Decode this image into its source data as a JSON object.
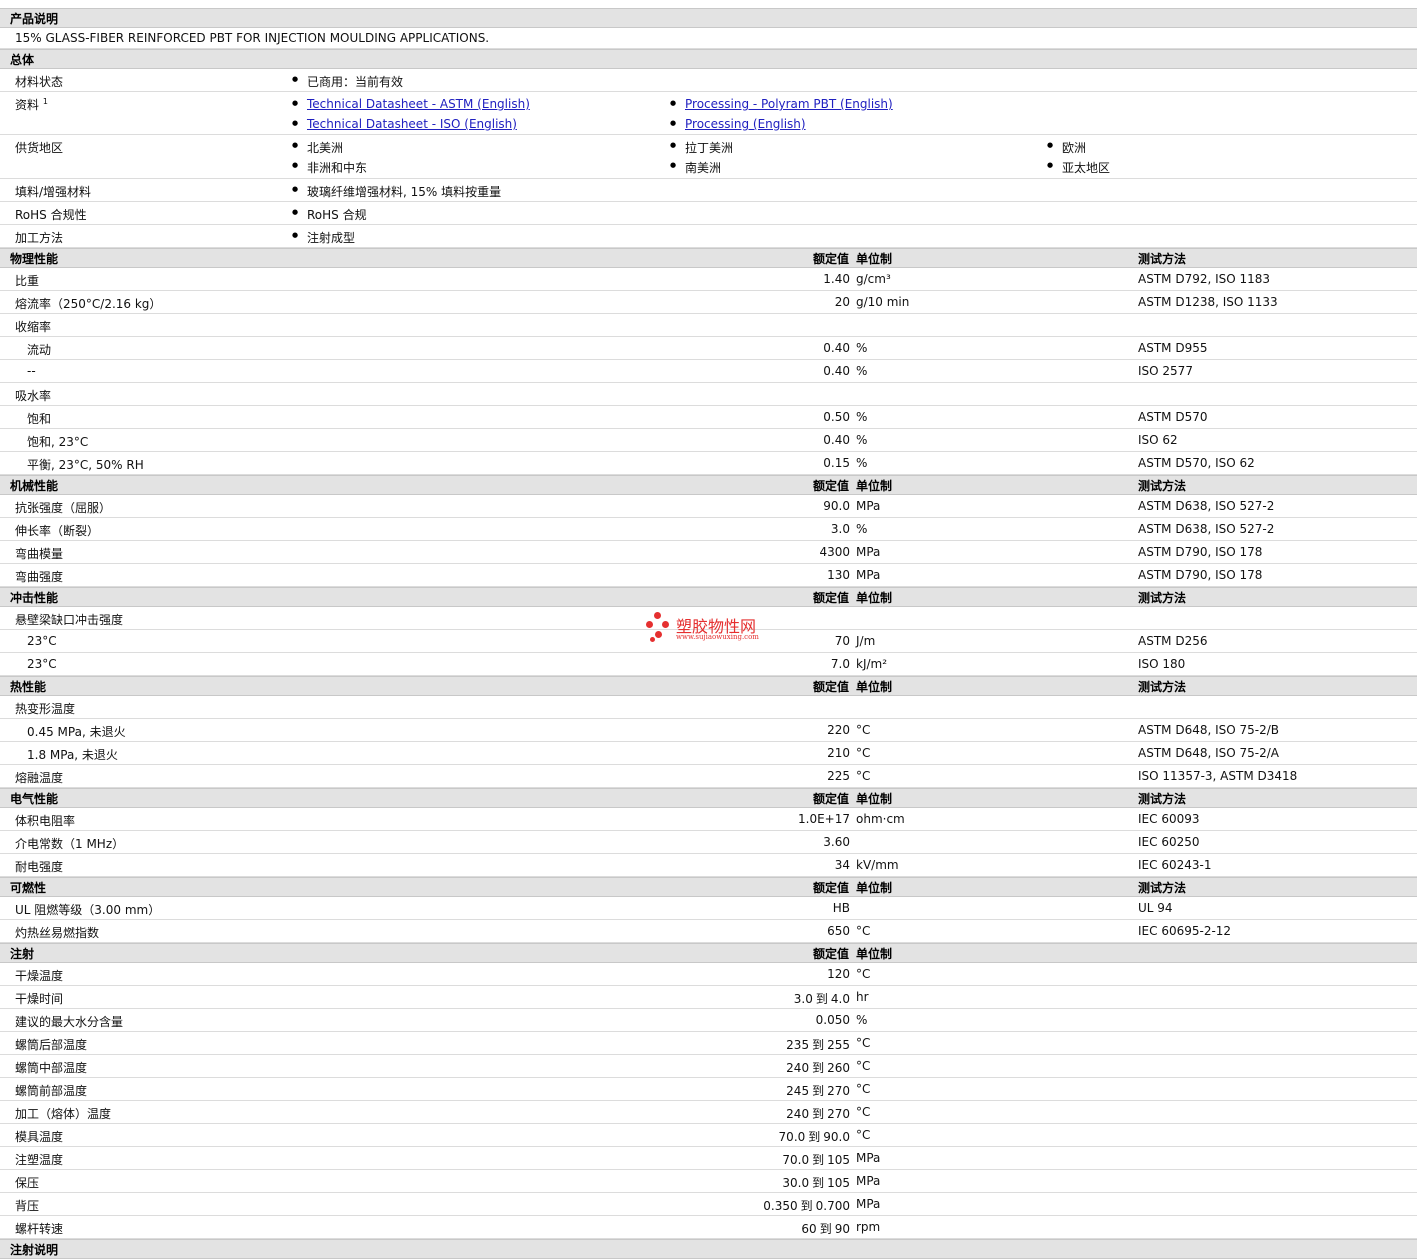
{
  "sections": {
    "desc": "产品说明",
    "general": "总体",
    "physical": "物理性能",
    "mechanical": "机械性能",
    "impact": "冲击性能",
    "thermal": "热性能",
    "electrical": "电气性能",
    "flammability": "可燃性",
    "injection": "注射",
    "injection_notes": "注射说明"
  },
  "headers": {
    "value": "额定值",
    "unit": "单位制",
    "method": "测试方法"
  },
  "description": "15% GLASS-FIBER REINFORCED PBT FOR INJECTION MOULDING APPLICATIONS.",
  "general": {
    "status_label": "材料状态",
    "status_value": "已商用：当前有效",
    "docs_label": "资料",
    "docs_sup": "1",
    "docs": [
      "Technical Datasheet - ASTM (English)",
      "Processing - Polyram PBT (English)",
      "Technical Datasheet - ISO (English)",
      "Processing (English)"
    ],
    "regions_label": "供货地区",
    "regions": [
      "北美洲",
      "拉丁美洲",
      "欧洲",
      "非洲和中东",
      "南美洲",
      "亚太地区"
    ],
    "filler_label": "填料/增强材料",
    "filler_value": "玻璃纤维增强材料, 15% 填料按重量",
    "rohs_label": "RoHS 合规性",
    "rohs_value": "RoHS 合规",
    "process_label": "加工方法",
    "process_value": "注射成型"
  },
  "physical": [
    {
      "label": "比重",
      "value": "1.40",
      "unit": "g/cm³",
      "method": "ASTM D792, ISO 1183"
    },
    {
      "label": "熔流率（250°C/2.16 kg）",
      "value": "20",
      "unit": "g/10 min",
      "method": "ASTM D1238, ISO 1133"
    },
    {
      "label": "收缩率",
      "value": "",
      "unit": "",
      "method": ""
    },
    {
      "label": "流动",
      "value": "0.40",
      "unit": "%",
      "method": "ASTM D955"
    },
    {
      "label": "--",
      "value": "0.40",
      "unit": "%",
      "method": "ISO 2577"
    },
    {
      "label": "吸水率",
      "value": "",
      "unit": "",
      "method": ""
    },
    {
      "label": "饱和",
      "value": "0.50",
      "unit": "%",
      "method": "ASTM D570"
    },
    {
      "label": "饱和, 23°C",
      "value": "0.40",
      "unit": "%",
      "method": "ISO 62"
    },
    {
      "label": "平衡, 23°C, 50% RH",
      "value": "0.15",
      "unit": "%",
      "method": "ASTM D570, ISO 62"
    }
  ],
  "mechanical": [
    {
      "label": "抗张强度（屈服）",
      "value": "90.0",
      "unit": "MPa",
      "method": "ASTM D638, ISO 527-2"
    },
    {
      "label": "伸长率（断裂）",
      "value": "3.0",
      "unit": "%",
      "method": "ASTM D638, ISO 527-2"
    },
    {
      "label": "弯曲模量",
      "value": "4300",
      "unit": "MPa",
      "method": "ASTM D790, ISO 178"
    },
    {
      "label": "弯曲强度",
      "value": "130",
      "unit": "MPa",
      "method": "ASTM D790, ISO 178"
    }
  ],
  "impact": [
    {
      "label": "悬壁梁缺口冲击强度",
      "value": "",
      "unit": "",
      "method": ""
    },
    {
      "label": "23°C",
      "value": "70",
      "unit": "J/m",
      "method": "ASTM D256"
    },
    {
      "label": "23°C",
      "value": "7.0",
      "unit": "kJ/m²",
      "method": "ISO 180"
    }
  ],
  "thermal": [
    {
      "label": "热变形温度",
      "value": "",
      "unit": "",
      "method": ""
    },
    {
      "label": "0.45 MPa, 未退火",
      "value": "220",
      "unit": "°C",
      "method": "ASTM D648, ISO 75-2/B"
    },
    {
      "label": "1.8 MPa, 未退火",
      "value": "210",
      "unit": "°C",
      "method": "ASTM D648, ISO 75-2/A"
    },
    {
      "label": "熔融温度",
      "value": "225",
      "unit": "°C",
      "method": "ISO 11357-3, ASTM D3418"
    }
  ],
  "electrical": [
    {
      "label": "体积电阻率",
      "value": "1.0E+17",
      "unit": "ohm·cm",
      "method": "IEC 60093"
    },
    {
      "label": "介电常数（1 MHz）",
      "value": "3.60",
      "unit": "",
      "method": "IEC 60250"
    },
    {
      "label": "耐电强度",
      "value": "34",
      "unit": "kV/mm",
      "method": "IEC 60243-1"
    }
  ],
  "flammability": [
    {
      "label": "UL 阻燃等级（3.00 mm）",
      "value": "HB",
      "unit": "",
      "method": "UL 94"
    },
    {
      "label": "灼热丝易燃指数",
      "value": "650",
      "unit": "°C",
      "method": "IEC 60695-2-12"
    }
  ],
  "injection": [
    {
      "label": "干燥温度",
      "value": "120",
      "unit": "°C"
    },
    {
      "label": "干燥时间",
      "lo": "3.0",
      "to": "到",
      "hi": "4.0",
      "unit": "hr"
    },
    {
      "label": "建议的最大水分含量",
      "value": "0.050",
      "unit": "%"
    },
    {
      "label": "螺筒后部温度",
      "lo": "235",
      "to": "到",
      "hi": "255",
      "unit": "°C"
    },
    {
      "label": "螺筒中部温度",
      "lo": "240",
      "to": "到",
      "hi": "260",
      "unit": "°C"
    },
    {
      "label": "螺筒前部温度",
      "lo": "245",
      "to": "到",
      "hi": "270",
      "unit": "°C"
    },
    {
      "label": "加工（熔体）温度",
      "lo": "240",
      "to": "到",
      "hi": "270",
      "unit": "°C"
    },
    {
      "label": "模具温度",
      "lo": "70.0",
      "to": "到",
      "hi": "90.0",
      "unit": "°C"
    },
    {
      "label": "注塑温度",
      "lo": "70.0",
      "to": "到",
      "hi": "105",
      "unit": "MPa"
    },
    {
      "label": "保压",
      "lo": "30.0",
      "to": "到",
      "hi": "105",
      "unit": "MPa"
    },
    {
      "label": "背压",
      "lo": "0.350",
      "to": "到",
      "hi": "0.700",
      "unit": "MPa"
    },
    {
      "label": "螺杆转速",
      "lo": "60",
      "to": "到",
      "hi": "90",
      "unit": "rpm"
    }
  ],
  "watermark": {
    "title": "塑胶物性网",
    "url": "www.sujiaowuxing.com"
  }
}
